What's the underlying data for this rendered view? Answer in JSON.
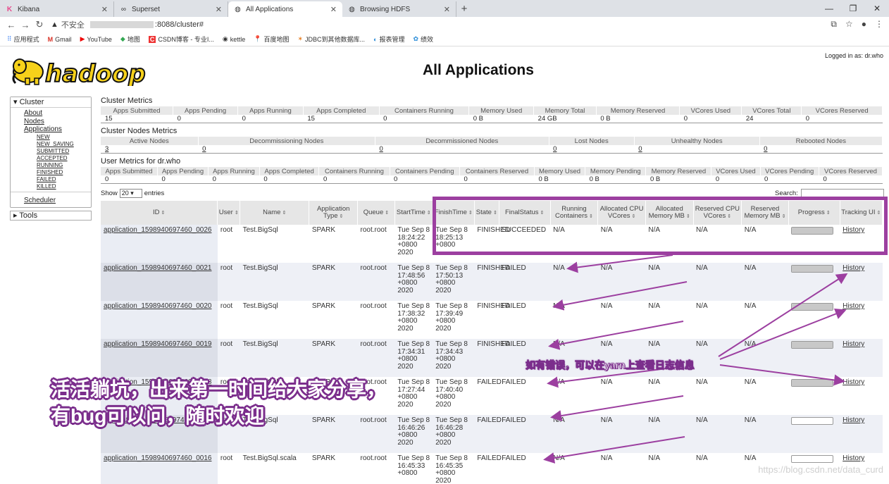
{
  "browser": {
    "tabs": [
      {
        "title": "Kibana",
        "icon": "kibana-icon",
        "active": false
      },
      {
        "title": "Superset",
        "icon": "superset-icon",
        "active": false
      },
      {
        "title": "All Applications",
        "icon": "globe-icon",
        "active": true
      },
      {
        "title": "Browsing HDFS",
        "icon": "globe-icon",
        "active": false
      }
    ],
    "insecure_label": "不安全",
    "url": ":8088/cluster#",
    "bookmarks": [
      "应用程式",
      "Gmail",
      "YouTube",
      "地图",
      "CSDN博客 - 专业I...",
      "kettle",
      "百度地图",
      "JDBC到其他数据库...",
      "报表管理",
      "绩效"
    ]
  },
  "header": {
    "logo_text": "hadoop",
    "title": "All Applications",
    "logged_in": "Logged in as: dr.who"
  },
  "sidebar": {
    "cluster_label": "Cluster",
    "links": [
      "About",
      "Nodes",
      "Applications"
    ],
    "sub_links": [
      "NEW",
      "NEW_SAVING",
      "SUBMITTED",
      "ACCEPTED",
      "RUNNING",
      "FINISHED",
      "FAILED",
      "KILLED"
    ],
    "scheduler_label": "Scheduler",
    "tools_label": "Tools"
  },
  "cluster_metrics": {
    "title": "Cluster Metrics",
    "headers": [
      "Apps Submitted",
      "Apps Pending",
      "Apps Running",
      "Apps Completed",
      "Containers Running",
      "Memory Used",
      "Memory Total",
      "Memory Reserved",
      "VCores Used",
      "VCores Total",
      "VCores Reserved"
    ],
    "values": [
      "15",
      "0",
      "0",
      "15",
      "0",
      "0 B",
      "24 GB",
      "0 B",
      "0",
      "24",
      "0"
    ]
  },
  "node_metrics": {
    "title": "Cluster Nodes Metrics",
    "headers": [
      "Active Nodes",
      "Decommissioning Nodes",
      "Decommissioned Nodes",
      "Lost Nodes",
      "Unhealthy Nodes",
      "Rebooted Nodes"
    ],
    "values": [
      "3",
      "0",
      "0",
      "0",
      "0",
      "0"
    ]
  },
  "user_metrics": {
    "title": "User Metrics for dr.who",
    "headers": [
      "Apps Submitted",
      "Apps Pending",
      "Apps Running",
      "Apps Completed",
      "Containers Running",
      "Containers Pending",
      "Containers Reserved",
      "Memory Used",
      "Memory Pending",
      "Memory Reserved",
      "VCores Used",
      "VCores Pending",
      "VCores Reserved"
    ],
    "values": [
      "0",
      "0",
      "0",
      "0",
      "0",
      "0",
      "0",
      "0 B",
      "0 B",
      "0 B",
      "0",
      "0",
      "0"
    ]
  },
  "table_controls": {
    "show_label": "Show",
    "page_size": "20",
    "entries_label": "entries",
    "search_label": "Search:"
  },
  "apps_table": {
    "headers": [
      "ID",
      "User",
      "Name",
      "Application Type",
      "Queue",
      "StartTime",
      "FinishTime",
      "State",
      "FinalStatus",
      "Running Containers",
      "Allocated CPU VCores",
      "Allocated Memory MB",
      "Reserved CPU VCores",
      "Reserved Memory MB",
      "Progress",
      "Tracking UI"
    ],
    "rows": [
      {
        "id": "application_1598940697460_0026",
        "user": "root",
        "name": "Test.BigSql",
        "type": "SPARK",
        "queue": "root.root",
        "start": "Tue Sep 8 18:24:22 +0800 2020",
        "finish": "Tue Sep 8 18:25:13 +0800",
        "state": "FINISHED",
        "final": "SUCCEEDED",
        "rc": "N/A",
        "acpu": "N/A",
        "amem": "N/A",
        "rcpu": "N/A",
        "rmem": "N/A",
        "progress": 1.0,
        "ui": "History"
      },
      {
        "id": "application_1598940697460_0021",
        "user": "root",
        "name": "Test.BigSql",
        "type": "SPARK",
        "queue": "root.root",
        "start": "Tue Sep 8 17:48:56 +0800 2020",
        "finish": "Tue Sep 8 17:50:13 +0800 2020",
        "state": "FINISHED",
        "final": "FAILED",
        "rc": "N/A",
        "acpu": "N/A",
        "amem": "N/A",
        "rcpu": "N/A",
        "rmem": "N/A",
        "progress": 1.0,
        "ui": "History"
      },
      {
        "id": "application_1598940697460_0020",
        "user": "root",
        "name": "Test.BigSql",
        "type": "SPARK",
        "queue": "root.root",
        "start": "Tue Sep 8 17:38:32 +0800 2020",
        "finish": "Tue Sep 8 17:39:49 +0800 2020",
        "state": "FINISHED",
        "final": "FAILED",
        "rc": "N/A",
        "acpu": "N/A",
        "amem": "N/A",
        "rcpu": "N/A",
        "rmem": "N/A",
        "progress": 1.0,
        "ui": "History"
      },
      {
        "id": "application_1598940697460_0019",
        "user": "root",
        "name": "Test.BigSql",
        "type": "SPARK",
        "queue": "root.root",
        "start": "Tue Sep 8 17:34:31 +0800 2020",
        "finish": "Tue Sep 8 17:34:43 +0800 2020",
        "state": "FINISHED",
        "final": "FAILED",
        "rc": "N/A",
        "acpu": "N/A",
        "amem": "N/A",
        "rcpu": "N/A",
        "rmem": "N/A",
        "progress": 1.0,
        "ui": "History"
      },
      {
        "id": "application_1598940697460_0018",
        "user": "root",
        "name": "Test.BigSql",
        "type": "SPARK",
        "queue": "root.root",
        "start": "Tue Sep 8 17:27:44 +0800 2020",
        "finish": "Tue Sep 8 17:40:40 +0800 2020",
        "state": "FAILED",
        "final": "FAILED",
        "rc": "N/A",
        "acpu": "N/A",
        "amem": "N/A",
        "rcpu": "N/A",
        "rmem": "N/A",
        "progress": 1.0,
        "ui": "History"
      },
      {
        "id": "application_1598940697460_0017",
        "user": "root",
        "name": "Test.BigSql",
        "type": "SPARK",
        "queue": "root.root",
        "start": "Tue Sep 8 16:46:26 +0800 2020",
        "finish": "Tue Sep 8 16:46:28 +0800 2020",
        "state": "FAILED",
        "final": "FAILED",
        "rc": "N/A",
        "acpu": "N/A",
        "amem": "N/A",
        "rcpu": "N/A",
        "rmem": "N/A",
        "progress": 0.0,
        "ui": "History"
      },
      {
        "id": "application_1598940697460_0016",
        "user": "root",
        "name": "Test.BigSql.scala",
        "type": "SPARK",
        "queue": "root.root",
        "start": "Tue Sep 8 16:45:33 +0800",
        "finish": "Tue Sep 8 16:45:35 +0800 2020",
        "state": "FAILED",
        "final": "FAILED",
        "rc": "N/A",
        "acpu": "N/A",
        "amem": "N/A",
        "rcpu": "N/A",
        "rmem": "N/A",
        "progress": 0.0,
        "ui": "History"
      }
    ]
  },
  "annotations": {
    "small_note": "如有错误，可以在yarn上查看日志信息",
    "big_note_line1": "活活躺坑，出来第一时间给大家分享，",
    "big_note_line2": "有bug可以问，随时欢迎",
    "watermark": "https://blog.csdn.net/data_curd",
    "highlight_color": "#9c3fa0"
  }
}
